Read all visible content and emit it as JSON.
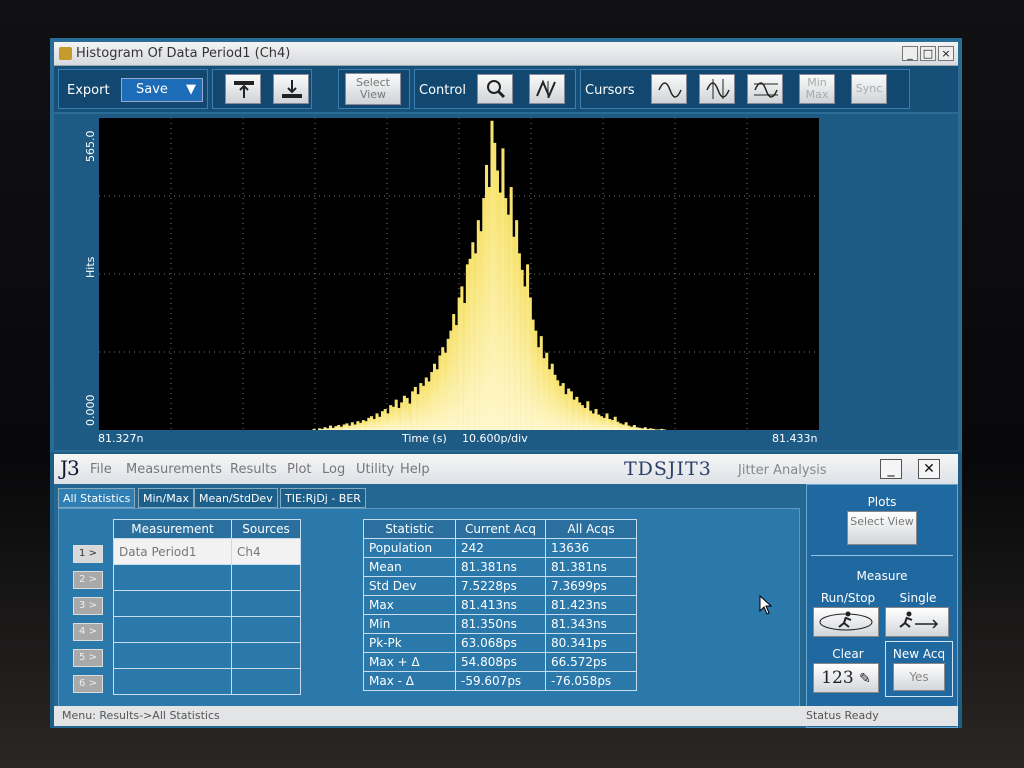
{
  "window": {
    "title": "Histogram Of Data Period1 (Ch4)",
    "controls": [
      "_",
      "□",
      "×"
    ]
  },
  "toolbar": {
    "export_label": "Export",
    "save_label": "Save",
    "select_view": "Select View",
    "control_label": "Control",
    "cursors_label": "Cursors",
    "minmax": "Min Max",
    "sync": "Sync"
  },
  "chart_data": {
    "type": "bar",
    "ylabel": "Hits",
    "ylim": [
      0,
      565
    ],
    "xlim": [
      "81.327n",
      "81.433n"
    ],
    "y_max_label": "565.0",
    "y_min_label": "0.000",
    "x_left_label": "81.327n",
    "x_right_label": "81.433n",
    "xlabel": "Time (s)",
    "scale_label": "10.600p/div",
    "grid": true,
    "bar_color": "#f4dd6a",
    "values": [
      0,
      0,
      0,
      0,
      0,
      0,
      0,
      0,
      0,
      0,
      0,
      0,
      0,
      0,
      0,
      0,
      0,
      0,
      0,
      0,
      0,
      0,
      0,
      0,
      0,
      0,
      0,
      0,
      0,
      0,
      0,
      0,
      0,
      0,
      0,
      0,
      0,
      0,
      0,
      0,
      0,
      0,
      0,
      0,
      0,
      0,
      0,
      0,
      0,
      0,
      0,
      0,
      0,
      0,
      0,
      0,
      0,
      0,
      0,
      0,
      0,
      0,
      0,
      0,
      0,
      0,
      0,
      0,
      0,
      0,
      0,
      0,
      0,
      0,
      0,
      0,
      0,
      0,
      2,
      0,
      3,
      2,
      5,
      3,
      8,
      4,
      7,
      9,
      6,
      10,
      12,
      8,
      14,
      10,
      16,
      13,
      18,
      16,
      22,
      25,
      20,
      30,
      24,
      34,
      38,
      30,
      45,
      42,
      55,
      40,
      50,
      62,
      58,
      48,
      70,
      78,
      65,
      85,
      80,
      95,
      88,
      105,
      120,
      110,
      135,
      150,
      140,
      165,
      180,
      210,
      190,
      240,
      260,
      230,
      300,
      310,
      340,
      320,
      380,
      360,
      420,
      480,
      440,
      560,
      520,
      470,
      430,
      510,
      420,
      390,
      440,
      350,
      380,
      320,
      290,
      260,
      300,
      240,
      200,
      180,
      150,
      170,
      130,
      140,
      110,
      120,
      100,
      90,
      80,
      85,
      65,
      75,
      70,
      55,
      60,
      50,
      45,
      40,
      52,
      35,
      30,
      38,
      28,
      25,
      22,
      30,
      20,
      18,
      24,
      15,
      12,
      10,
      14,
      8,
      6,
      9,
      5,
      4,
      3,
      5,
      2,
      3,
      2,
      1,
      1,
      2,
      1,
      0,
      0,
      0,
      0,
      0,
      0,
      0,
      0,
      0,
      0,
      0,
      0,
      0,
      0,
      0,
      0,
      0,
      0,
      0,
      0,
      0,
      0,
      0,
      0,
      0,
      0,
      0,
      0,
      0,
      0,
      0,
      0,
      0,
      0,
      0,
      0,
      0,
      0,
      0,
      0,
      0,
      0,
      0,
      0,
      0,
      0,
      0,
      0,
      0,
      0,
      0,
      0,
      0,
      0,
      0,
      0
    ]
  },
  "j3": {
    "logo": "J3",
    "menus": [
      "File",
      "Measurements",
      "Results",
      "Plot",
      "Log",
      "Utility",
      "Help"
    ],
    "product": "TDSJIT3",
    "product_sub": "Jitter Analysis"
  },
  "tabs": [
    "All Statistics",
    "Min/Max",
    "Mean/StdDev",
    "TIE:RjDj - BER"
  ],
  "measurement_table": {
    "headers": [
      "Measurement",
      "Sources"
    ],
    "rows": [
      [
        "Data Period1",
        "Ch4"
      ],
      [
        "",
        ""
      ],
      [
        "",
        ""
      ],
      [
        "",
        ""
      ],
      [
        "",
        ""
      ],
      [
        "",
        ""
      ]
    ]
  },
  "row_buttons": [
    "1 >",
    "2 >",
    "3 >",
    "4 >",
    "5 >",
    "6 >"
  ],
  "stats_table": {
    "headers": [
      "Statistic",
      "Current Acq",
      "All Acqs"
    ],
    "rows": [
      [
        "Population",
        "242",
        "13636"
      ],
      [
        "Mean",
        "81.381ns",
        "81.381ns"
      ],
      [
        "Std Dev",
        "7.5228ps",
        "7.3699ps"
      ],
      [
        "Max",
        "81.413ns",
        "81.423ns"
      ],
      [
        "Min",
        "81.350ns",
        "81.343ns"
      ],
      [
        "Pk-Pk",
        "63.068ps",
        "80.341ps"
      ],
      [
        "Max + Δ",
        "54.808ps",
        "66.572ps"
      ],
      [
        "Max - Δ",
        "-59.607ps",
        "-76.058ps"
      ]
    ]
  },
  "right_panel": {
    "plots": "Plots",
    "select_view": "Select View",
    "measure": "Measure",
    "run_stop": "Run/Stop",
    "single": "Single",
    "clear": "Clear",
    "clear_btn": "123",
    "new_acq": "New Acq",
    "yes": "Yes"
  },
  "status": {
    "menu_path": "Menu: Results->All Statistics",
    "status": "Status  Ready"
  }
}
